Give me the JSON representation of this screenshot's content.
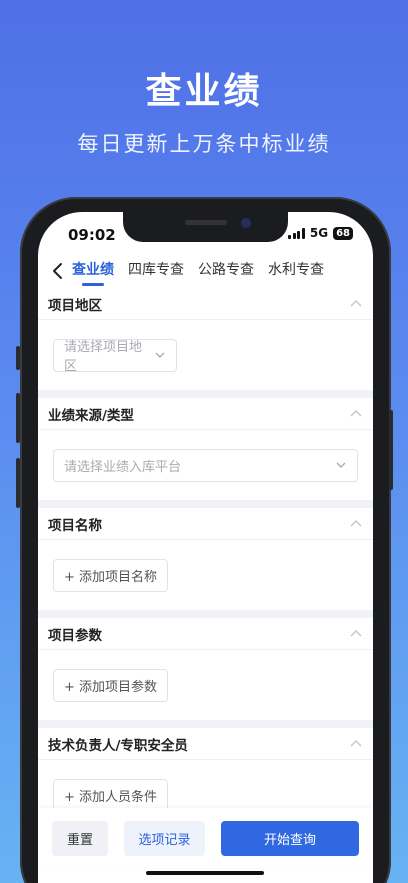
{
  "promo": {
    "title": "查业绩",
    "subtitle": "每日更新上万条中标业绩"
  },
  "status_bar": {
    "time": "09:02",
    "network": "5G",
    "battery": "68"
  },
  "nav": {
    "tabs": [
      {
        "label": "查业绩",
        "active": true
      },
      {
        "label": "四库专查",
        "active": false
      },
      {
        "label": "公路专查",
        "active": false
      },
      {
        "label": "水利专查",
        "active": false
      }
    ]
  },
  "sections": [
    {
      "title": "项目地区",
      "control": "select",
      "placeholder": "请选择项目地区"
    },
    {
      "title": "业绩来源/类型",
      "control": "select-wide",
      "placeholder": "请选择业绩入库平台"
    },
    {
      "title": "项目名称",
      "control": "add",
      "button_label": "+ 添加项目名称"
    },
    {
      "title": "项目参数",
      "control": "add",
      "button_label": "+ 添加项目参数"
    },
    {
      "title": "技术负责人/专职安全员",
      "control": "add",
      "button_label": "+ 添加人员条件"
    }
  ],
  "bottom_bar": {
    "reset_label": "重置",
    "history_label": "选项记录",
    "search_label": "开始查询"
  },
  "colors": {
    "accent": "#2f68e0",
    "background_top": "#4f6fe6",
    "background_bottom": "#67b3f2"
  }
}
